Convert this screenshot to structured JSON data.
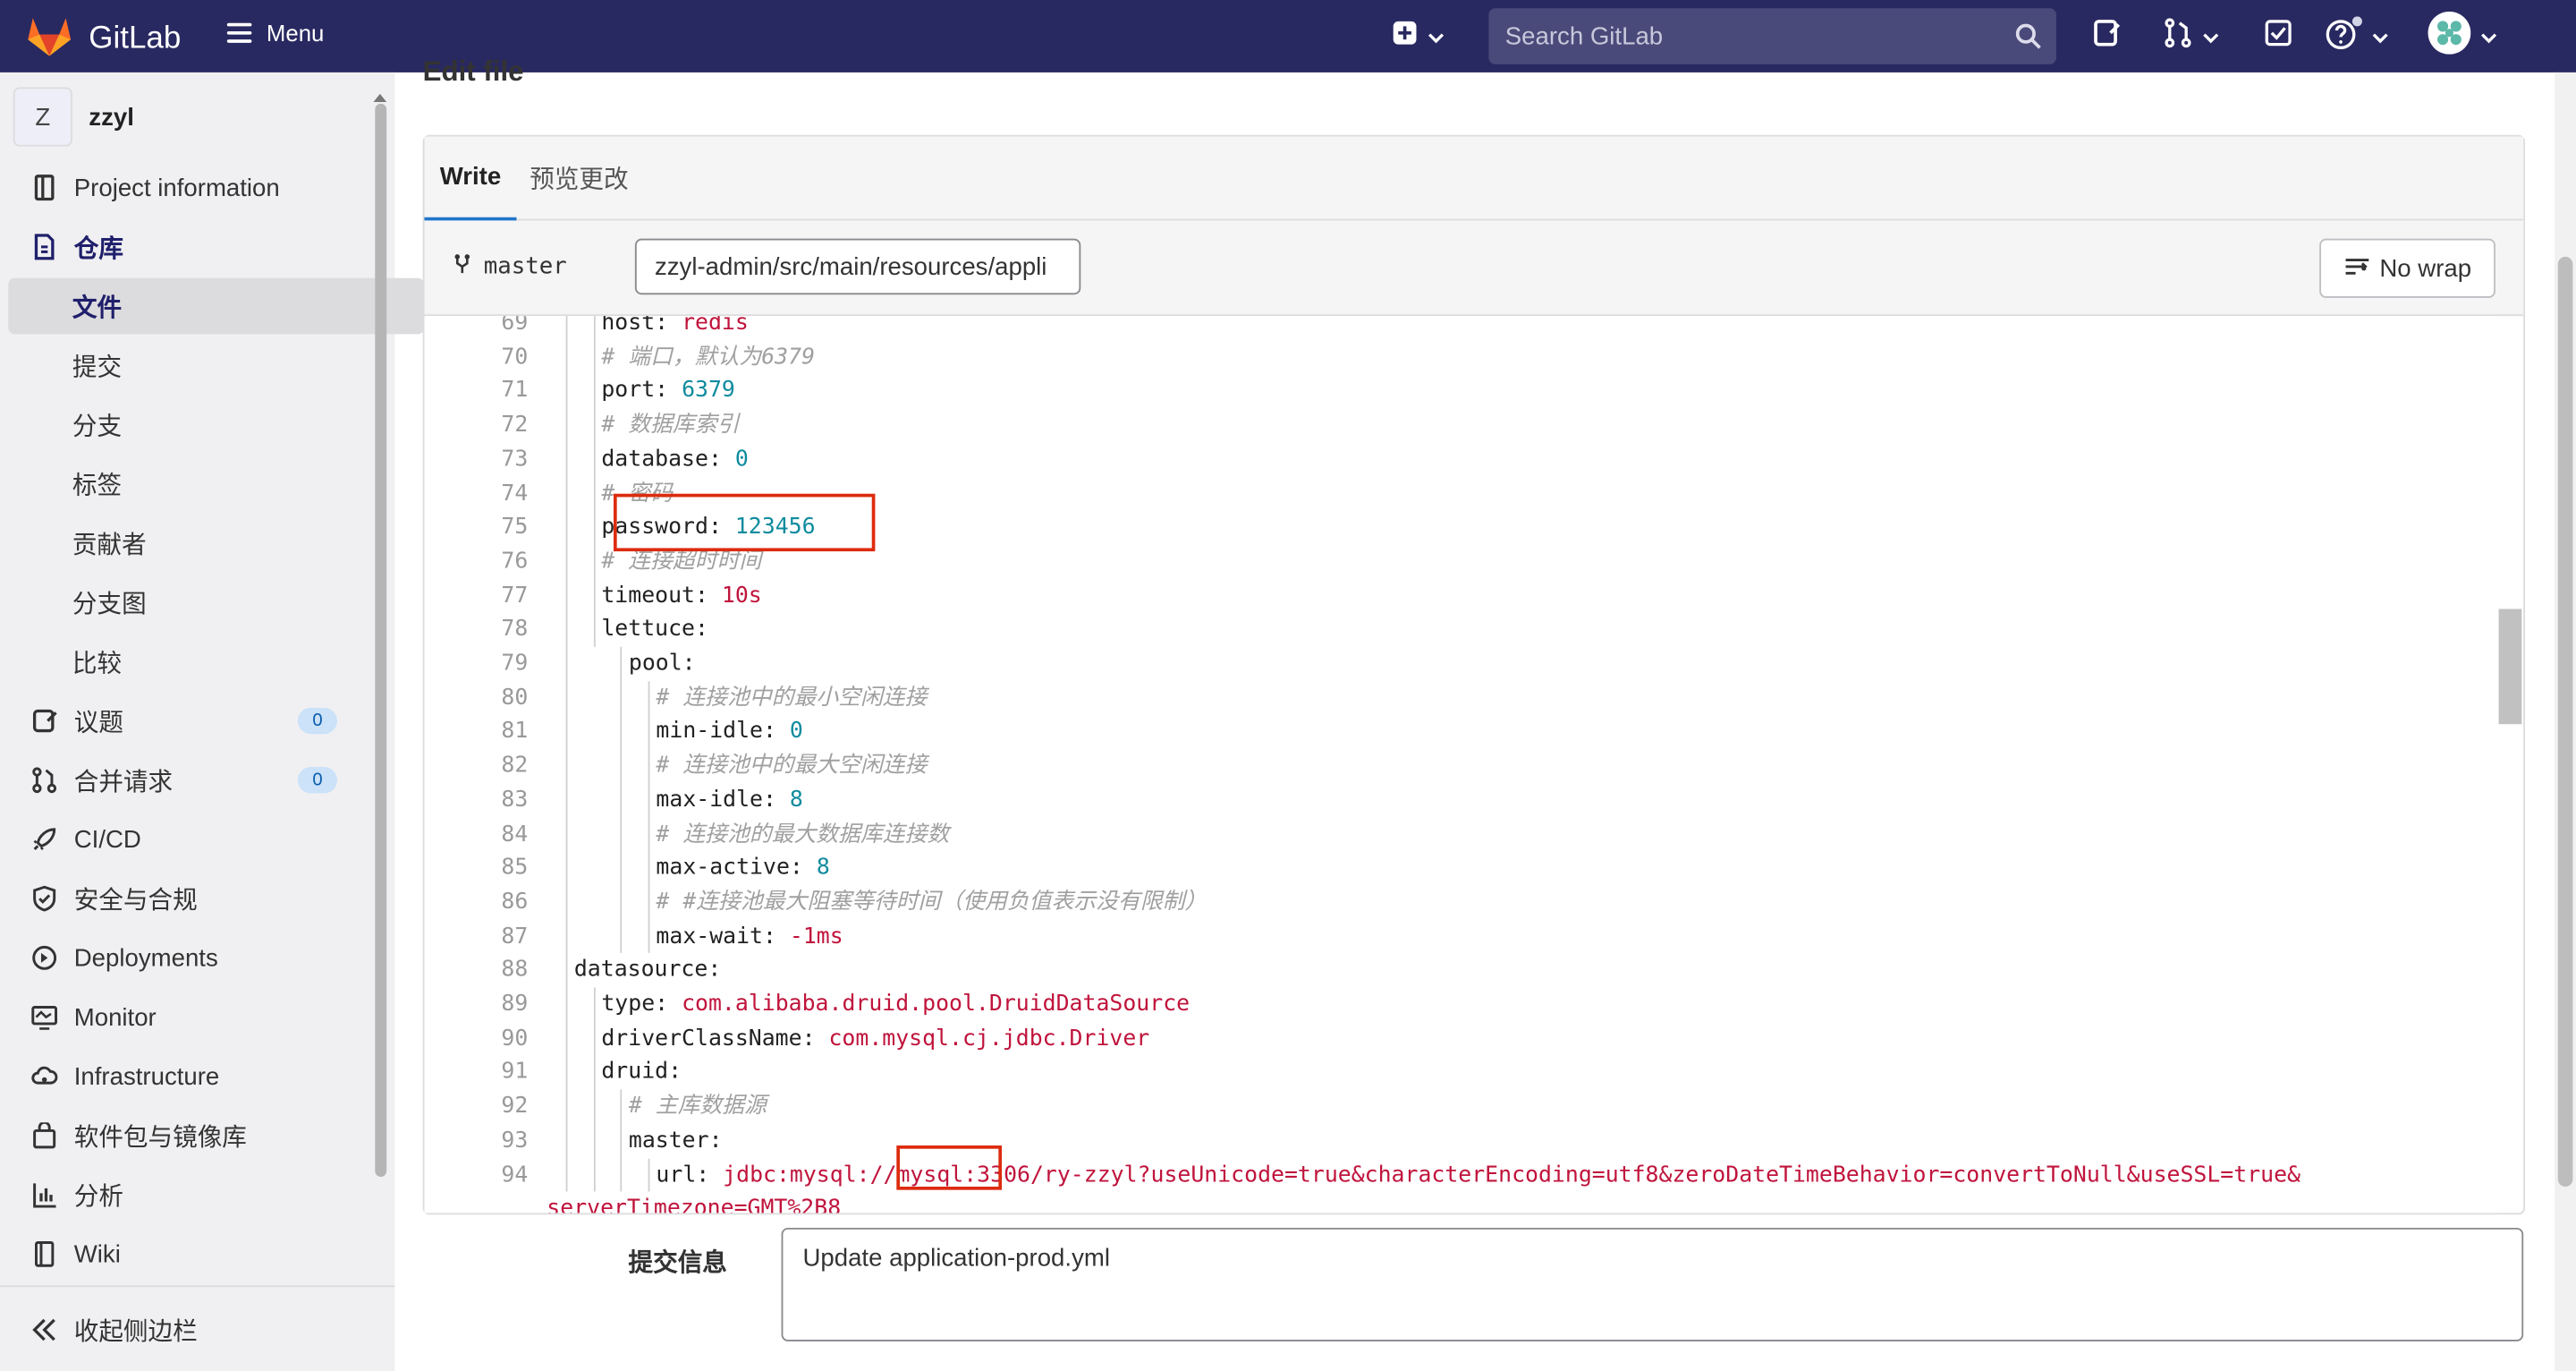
{
  "topbar": {
    "brand": "GitLab",
    "menu_label": "Menu",
    "search_placeholder": "Search GitLab"
  },
  "sidebar": {
    "project_initial": "Z",
    "project_name": "zzyl",
    "items": [
      {
        "label": "Project information",
        "icon": "project-info-icon"
      },
      {
        "label": "仓库",
        "icon": "repository-icon"
      },
      {
        "label": "文件"
      },
      {
        "label": "提交"
      },
      {
        "label": "分支"
      },
      {
        "label": "标签"
      },
      {
        "label": "贡献者"
      },
      {
        "label": "分支图"
      },
      {
        "label": "比较"
      },
      {
        "label": "议题",
        "icon": "issues-icon",
        "badge": "0"
      },
      {
        "label": "合并请求",
        "icon": "merge-request-icon",
        "badge": "0"
      },
      {
        "label": "CI/CD",
        "icon": "rocket-icon"
      },
      {
        "label": "安全与合规",
        "icon": "shield-icon"
      },
      {
        "label": "Deployments",
        "icon": "deployments-icon"
      },
      {
        "label": "Monitor",
        "icon": "monitor-icon"
      },
      {
        "label": "Infrastructure",
        "icon": "cloud-gear-icon"
      },
      {
        "label": "软件包与镜像库",
        "icon": "package-icon"
      },
      {
        "label": "分析",
        "icon": "chart-icon"
      },
      {
        "label": "Wiki",
        "icon": "book-icon"
      }
    ],
    "collapse_label": "收起侧边栏"
  },
  "editor": {
    "page_title": "Edit file",
    "tab_write": "Write",
    "tab_preview": "预览更改",
    "branch": "master",
    "file_path": "zzyl-admin/src/main/resources/appli",
    "nowrap_label": "No wrap",
    "lines": [
      {
        "n": "69",
        "indent": 2,
        "t": [
          [
            "k",
            "host: "
          ],
          [
            "s",
            "redis"
          ]
        ]
      },
      {
        "n": "70",
        "indent": 2,
        "t": [
          [
            "c",
            "# 端口，默认为6379"
          ]
        ]
      },
      {
        "n": "71",
        "indent": 2,
        "t": [
          [
            "k",
            "port: "
          ],
          [
            "n",
            "6379"
          ]
        ]
      },
      {
        "n": "72",
        "indent": 2,
        "t": [
          [
            "c",
            "# 数据库索引"
          ]
        ]
      },
      {
        "n": "73",
        "indent": 2,
        "t": [
          [
            "k",
            "database: "
          ],
          [
            "n",
            "0"
          ]
        ]
      },
      {
        "n": "74",
        "indent": 2,
        "t": [
          [
            "c",
            "# 密码"
          ]
        ]
      },
      {
        "n": "75",
        "indent": 2,
        "t": [
          [
            "k",
            "password: "
          ],
          [
            "n",
            "123456"
          ]
        ]
      },
      {
        "n": "76",
        "indent": 2,
        "t": [
          [
            "c",
            "# 连接超时时间"
          ]
        ]
      },
      {
        "n": "77",
        "indent": 2,
        "t": [
          [
            "k",
            "timeout: "
          ],
          [
            "s",
            "10s"
          ]
        ]
      },
      {
        "n": "78",
        "indent": 2,
        "t": [
          [
            "k",
            "lettuce:"
          ]
        ]
      },
      {
        "n": "79",
        "indent": 3,
        "t": [
          [
            "k",
            "pool:"
          ]
        ]
      },
      {
        "n": "80",
        "indent": 4,
        "t": [
          [
            "c",
            "# 连接池中的最小空闲连接"
          ]
        ]
      },
      {
        "n": "81",
        "indent": 4,
        "t": [
          [
            "k",
            "min-idle: "
          ],
          [
            "n",
            "0"
          ]
        ]
      },
      {
        "n": "82",
        "indent": 4,
        "t": [
          [
            "c",
            "# 连接池中的最大空闲连接"
          ]
        ]
      },
      {
        "n": "83",
        "indent": 4,
        "t": [
          [
            "k",
            "max-idle: "
          ],
          [
            "n",
            "8"
          ]
        ]
      },
      {
        "n": "84",
        "indent": 4,
        "t": [
          [
            "c",
            "# 连接池的最大数据库连接数"
          ]
        ]
      },
      {
        "n": "85",
        "indent": 4,
        "t": [
          [
            "k",
            "max-active: "
          ],
          [
            "n",
            "8"
          ]
        ]
      },
      {
        "n": "86",
        "indent": 4,
        "t": [
          [
            "c",
            "# #连接池最大阻塞等待时间（使用负值表示没有限制）"
          ]
        ]
      },
      {
        "n": "87",
        "indent": 4,
        "t": [
          [
            "k",
            "max-wait: "
          ],
          [
            "s",
            "-1ms"
          ]
        ]
      },
      {
        "n": "88",
        "indent": 1,
        "t": [
          [
            "k",
            "datasource:"
          ]
        ]
      },
      {
        "n": "89",
        "indent": 2,
        "t": [
          [
            "k",
            "type: "
          ],
          [
            "s",
            "com.alibaba.druid.pool.DruidDataSource"
          ]
        ]
      },
      {
        "n": "90",
        "indent": 2,
        "t": [
          [
            "k",
            "driverClassName: "
          ],
          [
            "s",
            "com.mysql.cj.jdbc.Driver"
          ]
        ]
      },
      {
        "n": "91",
        "indent": 2,
        "t": [
          [
            "k",
            "druid:"
          ]
        ]
      },
      {
        "n": "92",
        "indent": 3,
        "t": [
          [
            "c",
            "# 主库数据源"
          ]
        ]
      },
      {
        "n": "93",
        "indent": 3,
        "t": [
          [
            "k",
            "master:"
          ]
        ]
      },
      {
        "n": "94",
        "indent": 4,
        "t": [
          [
            "k",
            "url: "
          ],
          [
            "s",
            "jdbc:mysql://mysql:3306/ry-zzyl?useUnicode=true&characterEncoding=utf8&zeroDateTimeBehavior=convertToNull&useSSL=true&"
          ]
        ]
      },
      {
        "n": "",
        "indent": 0,
        "t": [
          [
            "s",
            "serverTimezone=GMT%2B8"
          ]
        ]
      }
    ]
  },
  "commit": {
    "label": "提交信息",
    "message": "Update application-prod.yml"
  },
  "colors": {
    "topbar": "#292961",
    "highlight_box": "#dd2b0e",
    "link": "#1f75cb"
  }
}
